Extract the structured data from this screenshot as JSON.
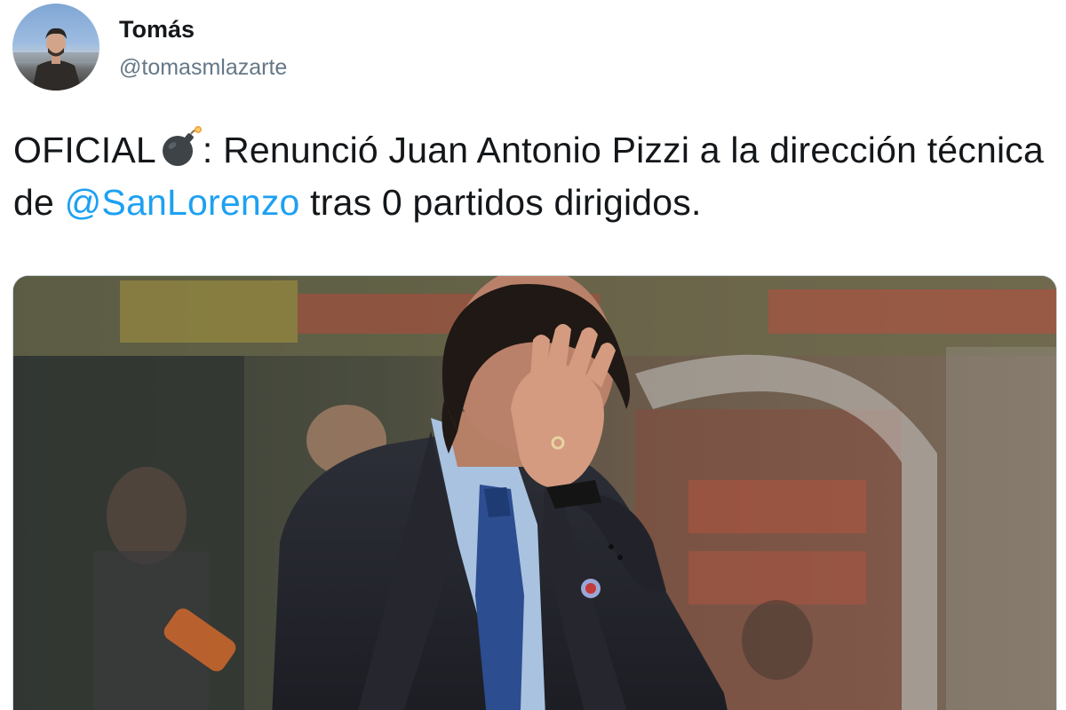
{
  "author": {
    "display_name": "Tomás",
    "handle": "@tomasmlazarte",
    "avatar_icon": "profile-photo"
  },
  "tweet": {
    "text_before": "OFICIAL",
    "emoji_icon": "bomb-emoji",
    "text_middle": ": Renunció Juan Antonio Pizzi a la dirección técnica de ",
    "mention": "@SanLorenzo",
    "text_after": " tras 0 partidos dirigidos."
  },
  "media": {
    "description_icon": "photo-coach-facepalm"
  },
  "colors": {
    "text": "#14171a",
    "secondary": "#657786",
    "link": "#1da1f2",
    "border": "#ccd6dd"
  }
}
